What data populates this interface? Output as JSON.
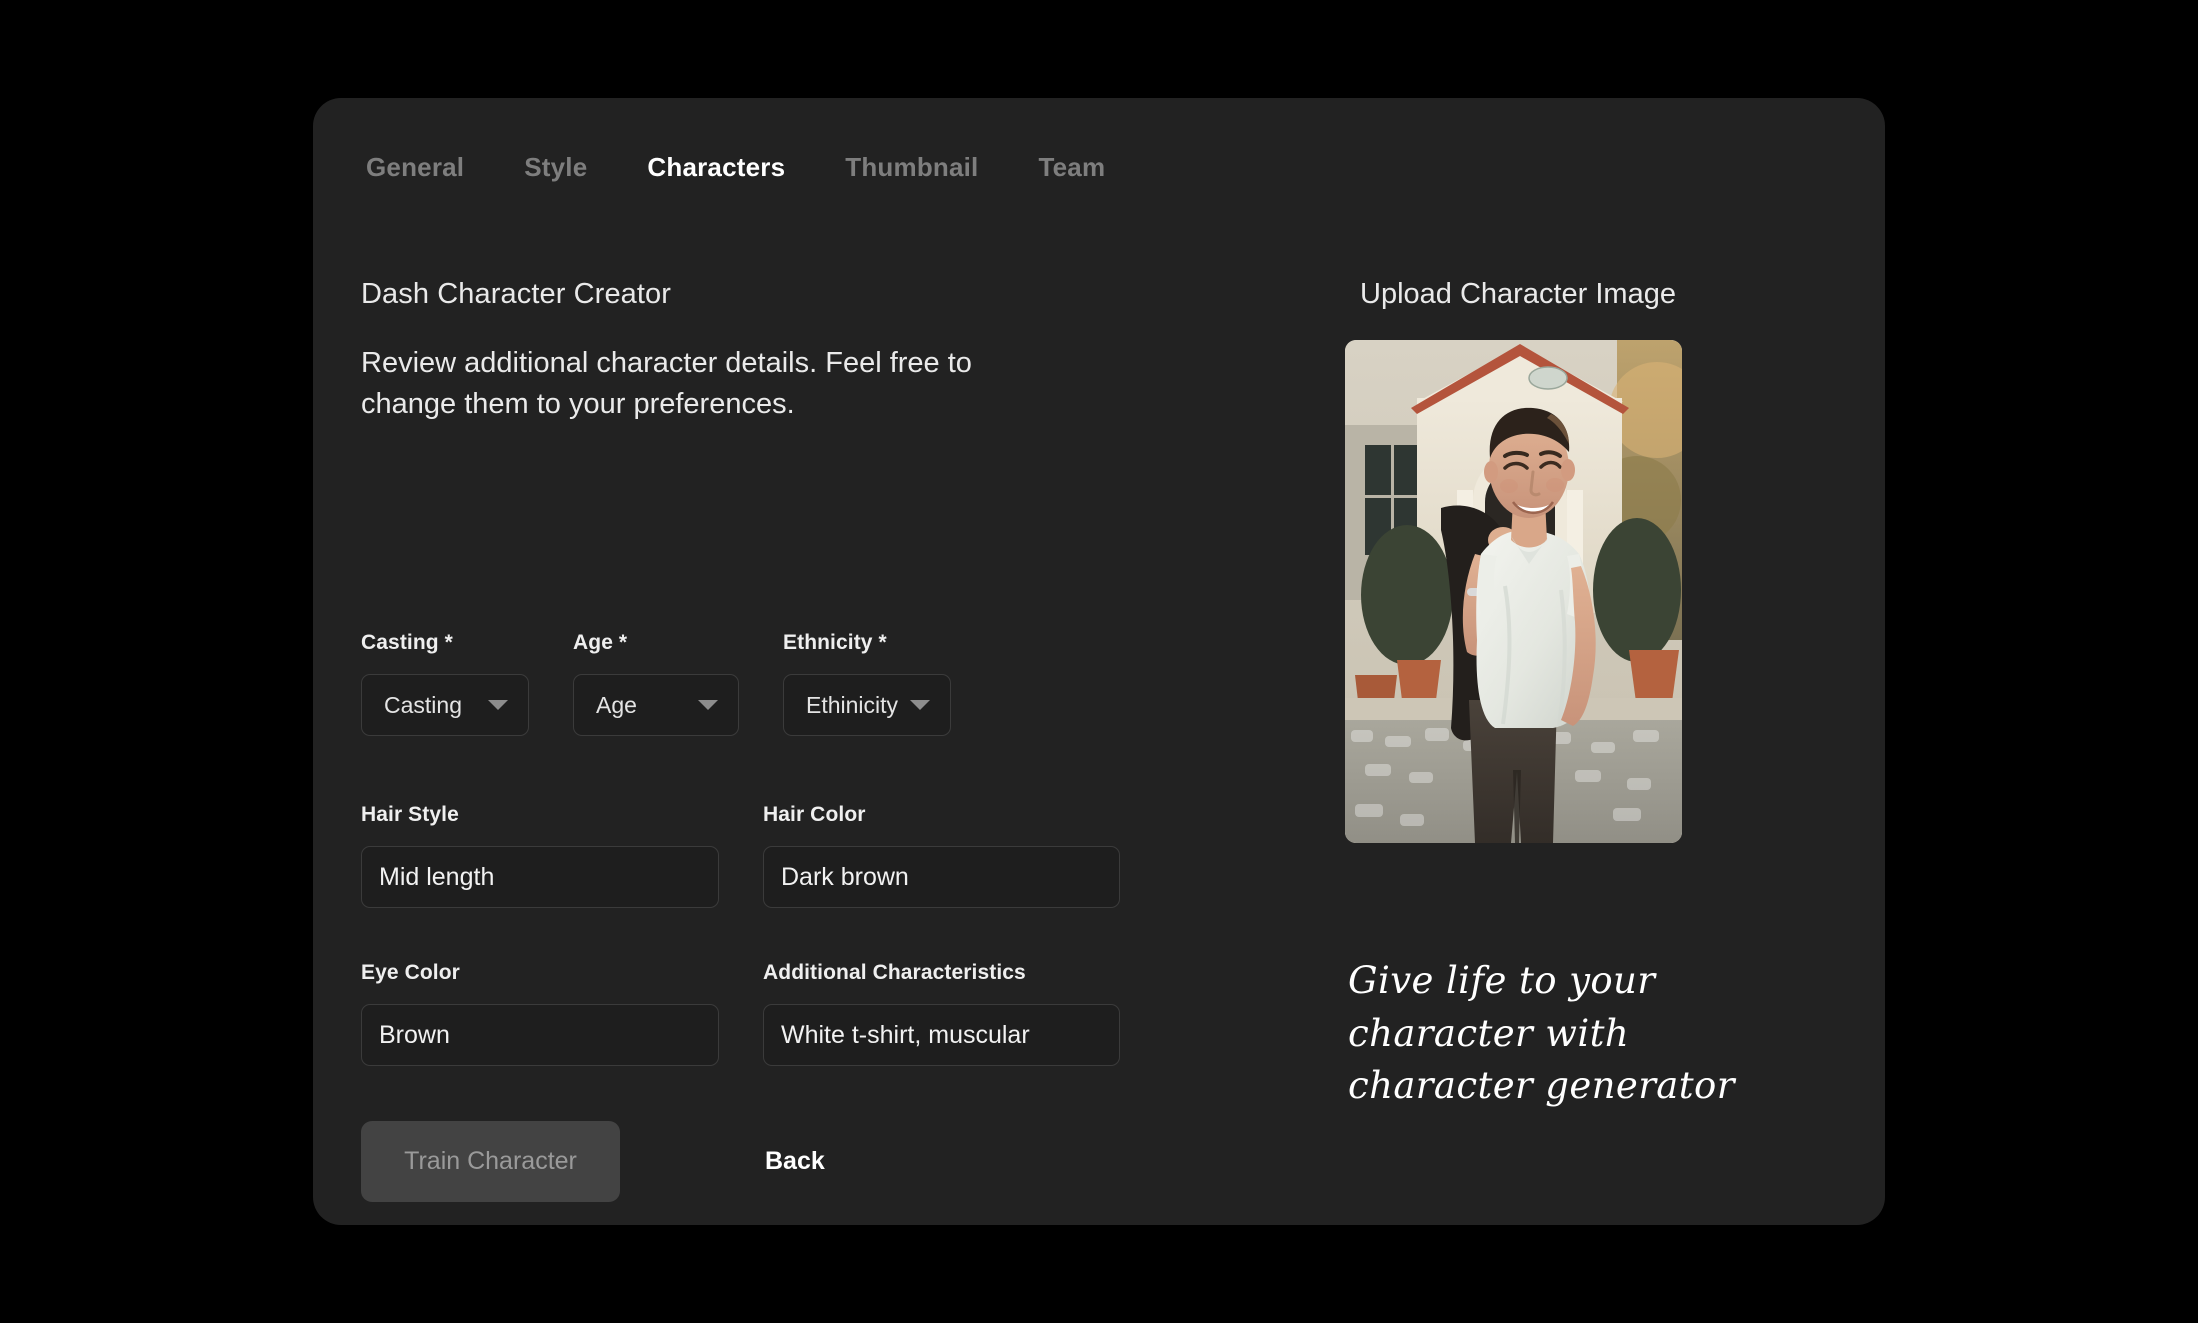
{
  "tabs": [
    {
      "label": "General",
      "active": false
    },
    {
      "label": "Style",
      "active": false
    },
    {
      "label": "Characters",
      "active": true
    },
    {
      "label": "Thumbnail",
      "active": false
    },
    {
      "label": "Team",
      "active": false
    }
  ],
  "left": {
    "title": "Dash Character Creator",
    "description": "Review additional character details. Feel free to change them to your preferences.",
    "selects": [
      {
        "label": "Casting *",
        "placeholder": "Casting",
        "icon": "chevron-down-icon"
      },
      {
        "label": "Age *",
        "placeholder": "Age",
        "icon": "chevron-down-icon"
      },
      {
        "label": "Ethnicity *",
        "placeholder": "Ethinicity",
        "icon": "chevron-down-icon"
      }
    ],
    "inputs": [
      {
        "label": "Hair Style",
        "value": "Mid length"
      },
      {
        "label": "Hair Color",
        "value": "Dark brown"
      },
      {
        "label": "Eye Color",
        "value": "Brown"
      },
      {
        "label": "Additional Characteristics",
        "value": "White t-shirt, muscular"
      }
    ],
    "train_button": "Train Character",
    "back_button": "Back"
  },
  "right": {
    "upload_title": "Upload Character Image",
    "caption_line1": "Give life to your",
    "caption_line2": "character with",
    "caption_line3": "character generator",
    "photo_alt": "smiling man in white t-shirt in front of house"
  },
  "colors": {
    "page_background": "#000000",
    "card_background": "#222222",
    "field_background": "#1e1e1e",
    "field_border": "#3b3b3b",
    "active_tab": "#ffffff",
    "inactive_tab": "#7e7e7e",
    "disabled_button": "#434343",
    "disabled_button_text": "#9a9a9a"
  }
}
